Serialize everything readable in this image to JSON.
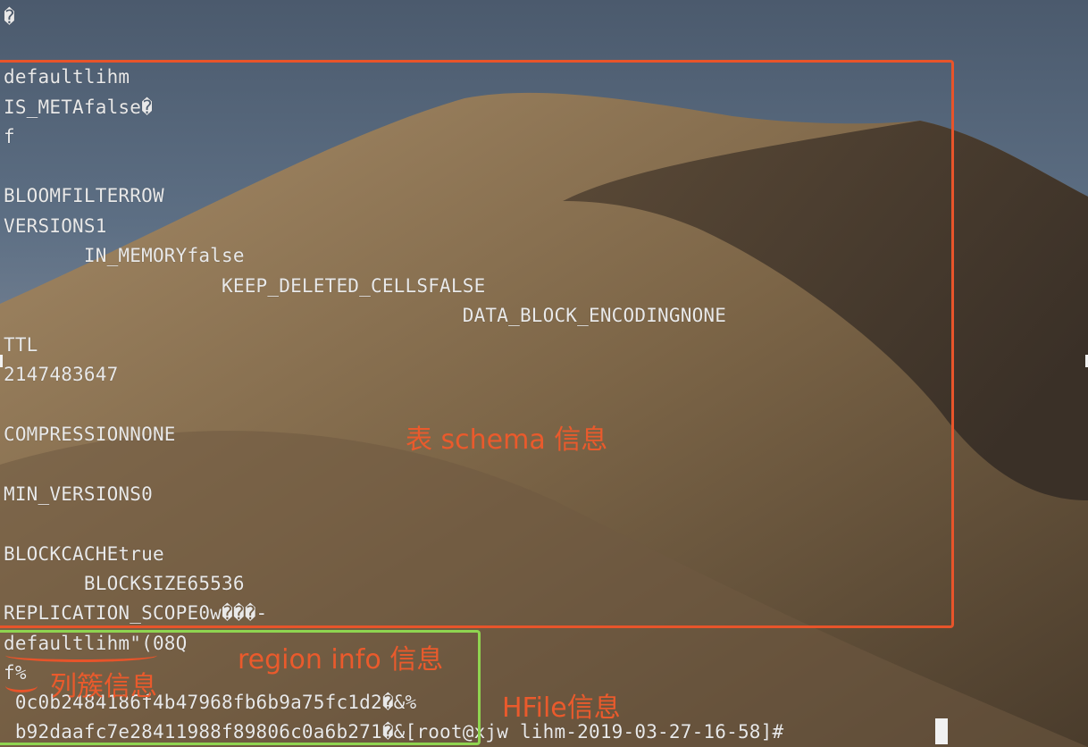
{
  "terminal": {
    "lines": [
      "�",
      "",
      "defaultlihm",
      "IS_METAfalse�",
      "f",
      "",
      "BLOOMFILTERROW",
      "VERSIONS1",
      "       IN_MEMORYfalse",
      "                   KEEP_DELETED_CELLSFALSE",
      "                                        DATA_BLOCK_ENCODINGNONE",
      "TTL",
      "2147483647",
      "",
      "COMPRESSIONNONE",
      "",
      "MIN_VERSIONS0",
      "",
      "BLOCKCACHEtrue",
      "       BLOCKSIZE65536",
      "REPLICATION_SCOPE0w���-",
      "defaultlihm\"(08Q",
      "f%",
      " 0c0b2484186f4b47968fb6b9a75fc1d2�&%",
      " b92daafc7e28411988f89806c0a6b271�&[root@xjw lihm-2019-03-27-16-58]#"
    ]
  },
  "annotations": {
    "schema_label": "表 schema 信息",
    "region_label": "region info 信息",
    "family_label": "列簇信息",
    "hfile_label": "HFile信息",
    "schema_color": "#e8542a",
    "region_color": "#8fd450"
  }
}
